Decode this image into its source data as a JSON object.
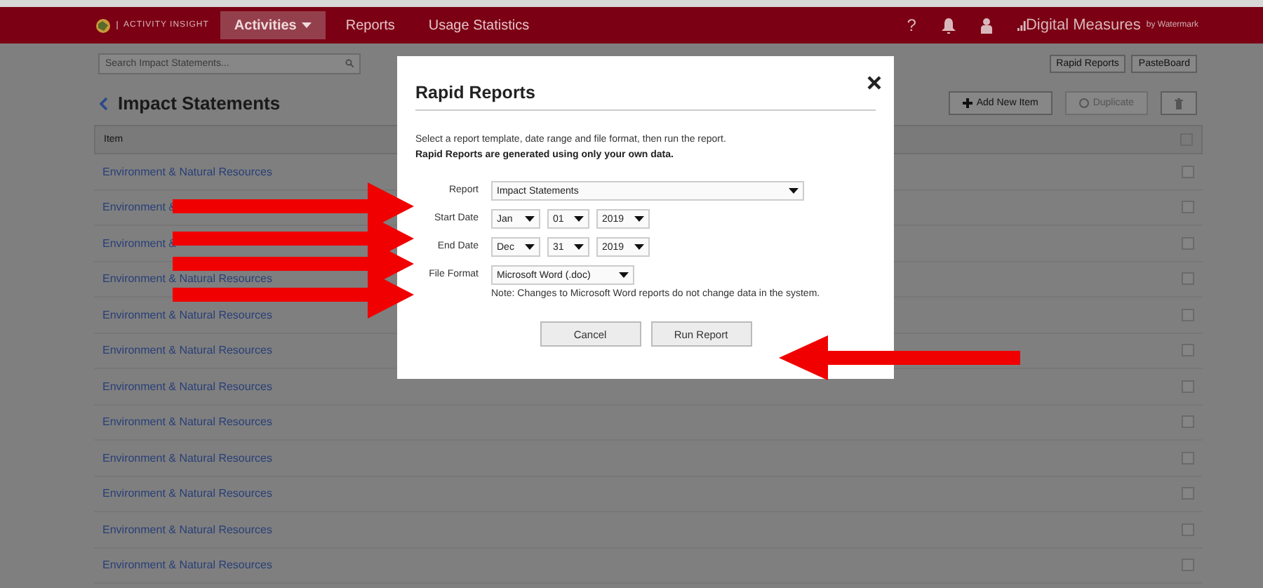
{
  "header": {
    "brand": "ACTIVITY INSIGHT",
    "nav": [
      {
        "label": "Activities",
        "selected": true,
        "dropdown": true
      },
      {
        "label": "Reports",
        "selected": false,
        "dropdown": false
      },
      {
        "label": "Usage Statistics",
        "selected": false,
        "dropdown": false
      }
    ],
    "help": "?",
    "vendor": "Digital Measures",
    "vendor_suffix": "by Watermark"
  },
  "search": {
    "placeholder": "Search Impact Statements..."
  },
  "toolbar_buttons": [
    "Rapid Reports",
    "PasteBoard"
  ],
  "page_title": "Impact Statements",
  "actions": [
    {
      "kind": "add",
      "label": "Add New Item",
      "disabled": false
    },
    {
      "kind": "duplicate",
      "label": "Duplicate",
      "disabled": true
    },
    {
      "kind": "delete"
    }
  ],
  "table": {
    "columns": [
      "Item"
    ],
    "all_checked": false,
    "rows": [
      {
        "item": "Environment & Natural Resources",
        "checked": false
      },
      {
        "item": "Environment &",
        "checked": false
      },
      {
        "item": "Environment &",
        "checked": false
      },
      {
        "item": "Environment & Natural Resources",
        "checked": false
      },
      {
        "item": "Environment & Natural Resources",
        "checked": false
      },
      {
        "item": "Environment & Natural Resources",
        "checked": false
      },
      {
        "item": "Environment & Natural Resources",
        "checked": false
      },
      {
        "item": "Environment & Natural Resources",
        "checked": false
      },
      {
        "item": "Environment & Natural Resources",
        "checked": false
      },
      {
        "item": "Environment & Natural Resources",
        "checked": false
      },
      {
        "item": "Environment & Natural Resources",
        "checked": false
      },
      {
        "item": "Environment & Natural Resources",
        "checked": false
      }
    ]
  },
  "modal": {
    "title": "Rapid Reports",
    "intro": "Select a report template, date range and file format, then run the report.",
    "notice": "Rapid Reports are generated using only your own data.",
    "fields": [
      {
        "kind": "select",
        "label": "Report",
        "value": "Impact Statements"
      },
      {
        "kind": "date",
        "label": "Start Date",
        "month": "Jan",
        "day": "01",
        "year": "2019"
      },
      {
        "kind": "date",
        "label": "End Date",
        "month": "Dec",
        "day": "31",
        "year": "2019"
      },
      {
        "kind": "select",
        "label": "File Format",
        "value": "Microsoft Word (.doc)",
        "note": "Note: Changes to Microsoft Word reports do not change data in the system."
      }
    ],
    "buttons": [
      "Cancel",
      "Run Report"
    ]
  },
  "arrows": [
    {
      "kind": "right"
    },
    {
      "kind": "right"
    },
    {
      "kind": "right"
    },
    {
      "kind": "right"
    },
    {
      "kind": "left"
    }
  ]
}
